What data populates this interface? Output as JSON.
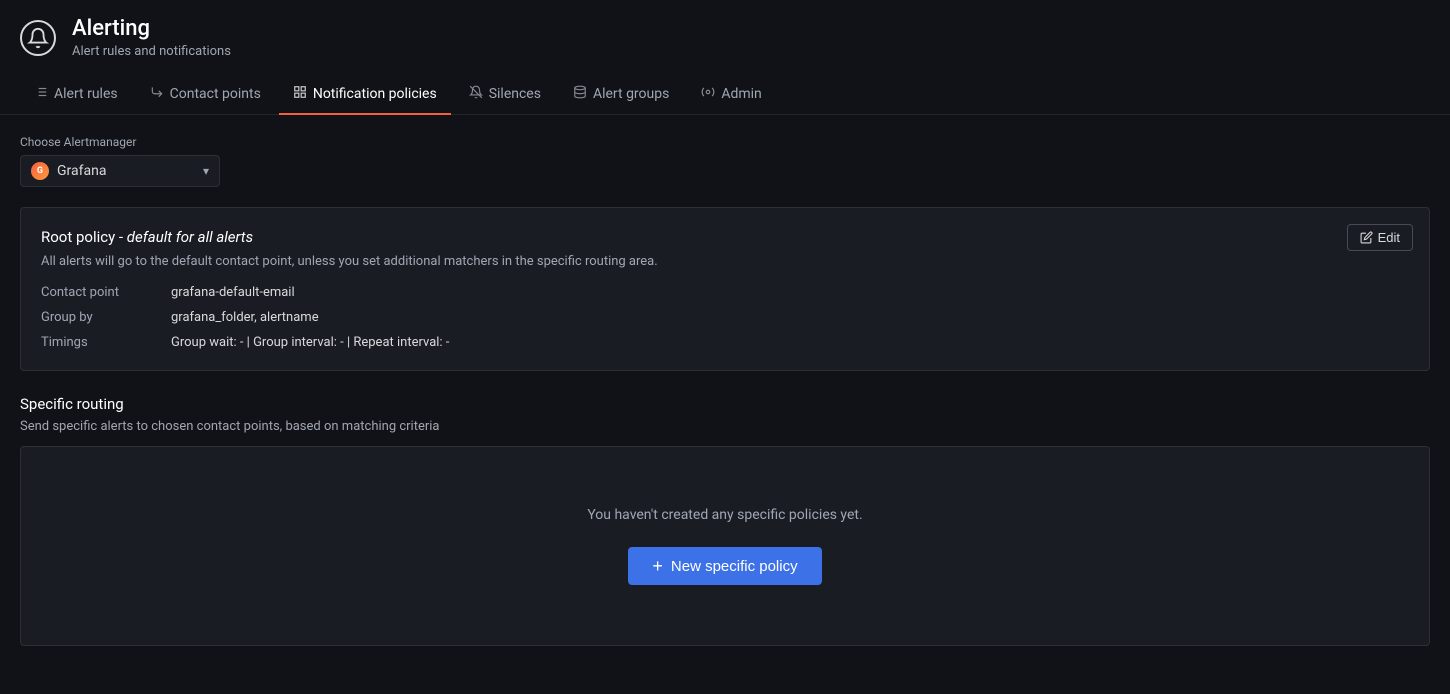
{
  "header": {
    "title": "Alerting",
    "subtitle": "Alert rules and notifications",
    "icon_symbol": "🔔"
  },
  "nav": {
    "tabs": [
      {
        "id": "alert-rules",
        "label": "Alert rules",
        "icon": "≡",
        "active": false
      },
      {
        "id": "contact-points",
        "label": "Contact points",
        "icon": "↩",
        "active": false
      },
      {
        "id": "notification-policies",
        "label": "Notification policies",
        "icon": "⊞",
        "active": true
      },
      {
        "id": "silences",
        "label": "Silences",
        "icon": "🔕",
        "active": false
      },
      {
        "id": "alert-groups",
        "label": "Alert groups",
        "icon": "◫",
        "active": false
      },
      {
        "id": "admin",
        "label": "Admin",
        "icon": "⚙",
        "active": false
      }
    ]
  },
  "alertmanager": {
    "label": "Choose Alertmanager",
    "value": "Grafana",
    "icon": "G"
  },
  "root_policy": {
    "title_prefix": "Root policy - ",
    "title_italic": "default for all alerts",
    "subtitle": "All alerts will go to the default contact point, unless you set additional matchers in the specific routing area.",
    "edit_label": "Edit",
    "contact_point_label": "Contact point",
    "contact_point_value": "grafana-default-email",
    "group_by_label": "Group by",
    "group_by_value": "grafana_folder, alertname",
    "timings_label": "Timings",
    "timings_value": "Group wait: - | Group interval: - | Repeat interval: -"
  },
  "specific_routing": {
    "title": "Specific routing",
    "subtitle": "Send specific alerts to chosen contact points, based on matching criteria",
    "empty_text": "You haven't created any specific policies yet.",
    "new_button_label": "New specific policy",
    "plus_icon": "+"
  }
}
